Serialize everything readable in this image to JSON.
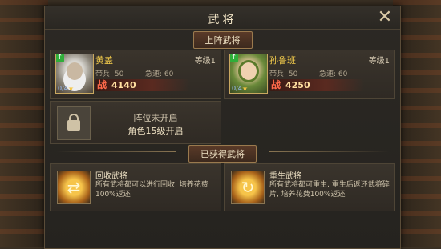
{
  "panel": {
    "title": "武将"
  },
  "sections": {
    "lineup": "上阵武将",
    "owned": "已获得武将"
  },
  "generals": [
    {
      "name": "黄盖",
      "level_label": "等级1",
      "troops_label": "带兵: 50",
      "speed_label": "急速: 60",
      "troop_count": "0/4",
      "power_glyph": "战",
      "power": "4140"
    },
    {
      "name": "孙鲁班",
      "level_label": "等级1",
      "troops_label": "带兵: 50",
      "speed_label": "急速: 60",
      "troop_count": "0/4",
      "power_glyph": "战",
      "power": "4250"
    }
  ],
  "locked_slot": {
    "line1": "阵位未开启",
    "line2": "角色15级开启"
  },
  "functions": [
    {
      "title": "回收武将",
      "desc": "所有武将都可以进行回收, 培养花费100%返还",
      "glyph": "⇄"
    },
    {
      "title": "重生武将",
      "desc": "所有武将都可重生, 重生后返还武将碎片, 培养花费100%返还",
      "glyph": "↻"
    }
  ],
  "colors": {
    "accent_gold": "#f0c94b",
    "power_red": "#ff6a4a",
    "upgrade_green": "#2fae3a"
  },
  "icons": {
    "close": "close-icon",
    "upgrade": "arrow-up-icon",
    "lock": "lock-icon",
    "recycle": "recycle-icon",
    "rebirth": "rebirth-icon"
  }
}
